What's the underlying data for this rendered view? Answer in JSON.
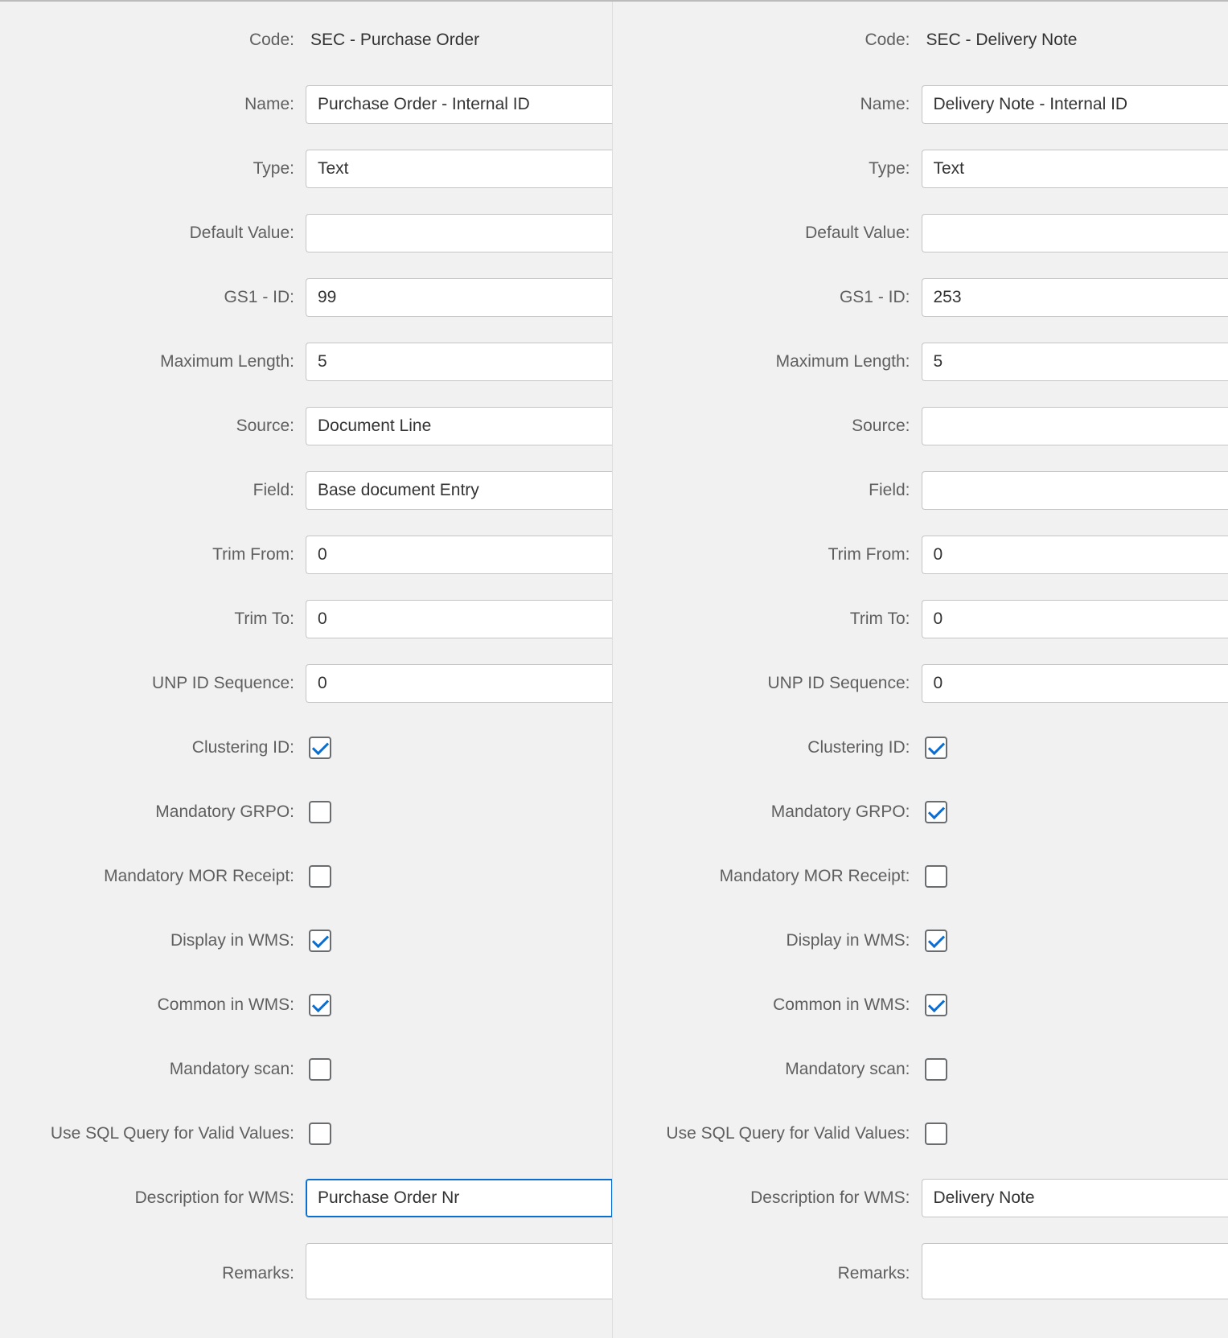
{
  "labels": {
    "code": "Code:",
    "name": "Name:",
    "type": "Type:",
    "default_value": "Default Value:",
    "gs1_id": "GS1 - ID:",
    "maximum_length": "Maximum Length:",
    "source": "Source:",
    "field": "Field:",
    "trim_from": "Trim From:",
    "trim_to": "Trim To:",
    "unp_id_sequence": "UNP ID Sequence:",
    "clustering_id": "Clustering ID:",
    "mandatory_grpo": "Mandatory GRPO:",
    "mandatory_mor_receipt": "Mandatory MOR Receipt:",
    "display_in_wms": "Display in WMS:",
    "common_in_wms": "Common in WMS:",
    "mandatory_scan": "Mandatory scan:",
    "use_sql_valid": "Use SQL Query for Valid Values:",
    "description_for_wms": "Description for WMS:",
    "remarks": "Remarks:"
  },
  "left": {
    "code": "SEC - Purchase Order",
    "name": "Purchase Order - Internal ID",
    "type": "Text",
    "default_value": "",
    "gs1_id": "99",
    "maximum_length": "5",
    "source": "Document Line",
    "field": "Base document Entry",
    "trim_from": "0",
    "trim_to": "0",
    "unp_id_sequence": "0",
    "clustering_id": true,
    "mandatory_grpo": false,
    "mandatory_mor_receipt": false,
    "display_in_wms": true,
    "common_in_wms": true,
    "mandatory_scan": false,
    "use_sql_valid": false,
    "description_for_wms": "Purchase Order Nr",
    "remarks": ""
  },
  "right": {
    "code": "SEC - Delivery Note",
    "name": "Delivery Note - Internal ID",
    "type": "Text",
    "default_value": "",
    "gs1_id": "253",
    "maximum_length": "5",
    "source": "",
    "field": "",
    "trim_from": "0",
    "trim_to": "0",
    "unp_id_sequence": "0",
    "clustering_id": true,
    "mandatory_grpo": true,
    "mandatory_mor_receipt": false,
    "display_in_wms": true,
    "common_in_wms": true,
    "mandatory_scan": false,
    "use_sql_valid": false,
    "description_for_wms": "Delivery Note",
    "remarks": ""
  }
}
